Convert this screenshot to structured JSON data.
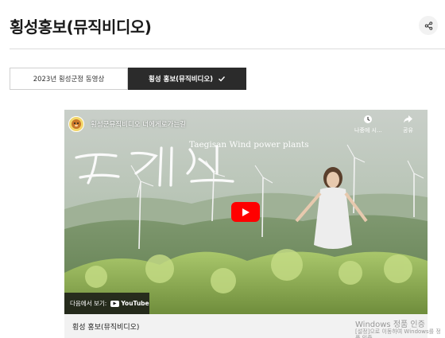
{
  "page": {
    "title": "횡성홍보(뮤직비디오)"
  },
  "tabs": [
    {
      "label": "2023년 횡성군정 동영상",
      "active": false
    },
    {
      "label": "횡성 홍보(뮤직비디오)",
      "active": true
    }
  ],
  "video": {
    "title": "횡성군뮤직비디오 너에게로가는길",
    "watch_later": "나중에 시...",
    "share": "공유",
    "overlay_text": "Taegisan Wind power plants",
    "hangul_script": "태기산",
    "watch_on": "다음에서 보기:",
    "youtube": "YouTube"
  },
  "caption": "횡성 홍보(뮤직비디오)",
  "watermark": {
    "line1": "Windows 정품 인증",
    "line2": "[설정]으로 이동하여 Windows를 정품 인증"
  },
  "colors": {
    "accent_dark": "#2b2b2b",
    "youtube_red": "#ff0000"
  }
}
